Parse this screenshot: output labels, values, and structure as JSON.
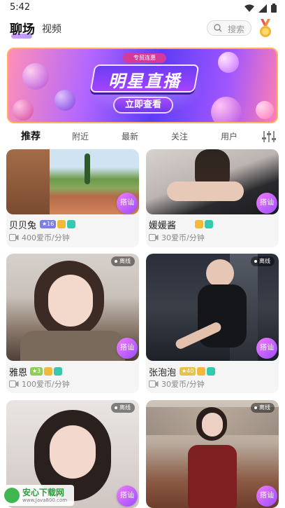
{
  "status": {
    "time": "5:42"
  },
  "header": {
    "tab_chat": "聊场",
    "tab_video": "视频",
    "search_label": "搜索"
  },
  "banner": {
    "tag": "专贸连惠",
    "title": "明星直播",
    "button": "立即查看"
  },
  "categories": [
    "推荐",
    "附近",
    "最新",
    "关注",
    "用户"
  ],
  "active_category": "推荐",
  "chat_label": "搭讪",
  "offline_label": "离线",
  "cards": [
    {
      "name": "贝贝兔",
      "level": "16",
      "price": "400爱币/分钟",
      "offline": false
    },
    {
      "name": "媛媛酱",
      "level": "",
      "price": "30爱币/分钟",
      "offline": false
    },
    {
      "name": "雅恩",
      "level": "3",
      "price": "100爱币/分钟",
      "offline": true
    },
    {
      "name": "张泡泡",
      "level": "40",
      "price": "30爱币/分钟",
      "offline": true
    },
    {
      "name": "",
      "level": "",
      "price": "",
      "offline": true
    },
    {
      "name": "",
      "level": "",
      "price": "",
      "offline": true
    }
  ],
  "watermark": {
    "title": "安心下载网",
    "url": "www.Java800.com"
  },
  "colors": {
    "accent": "#9b4dff",
    "chat_button": "#f27aff"
  }
}
